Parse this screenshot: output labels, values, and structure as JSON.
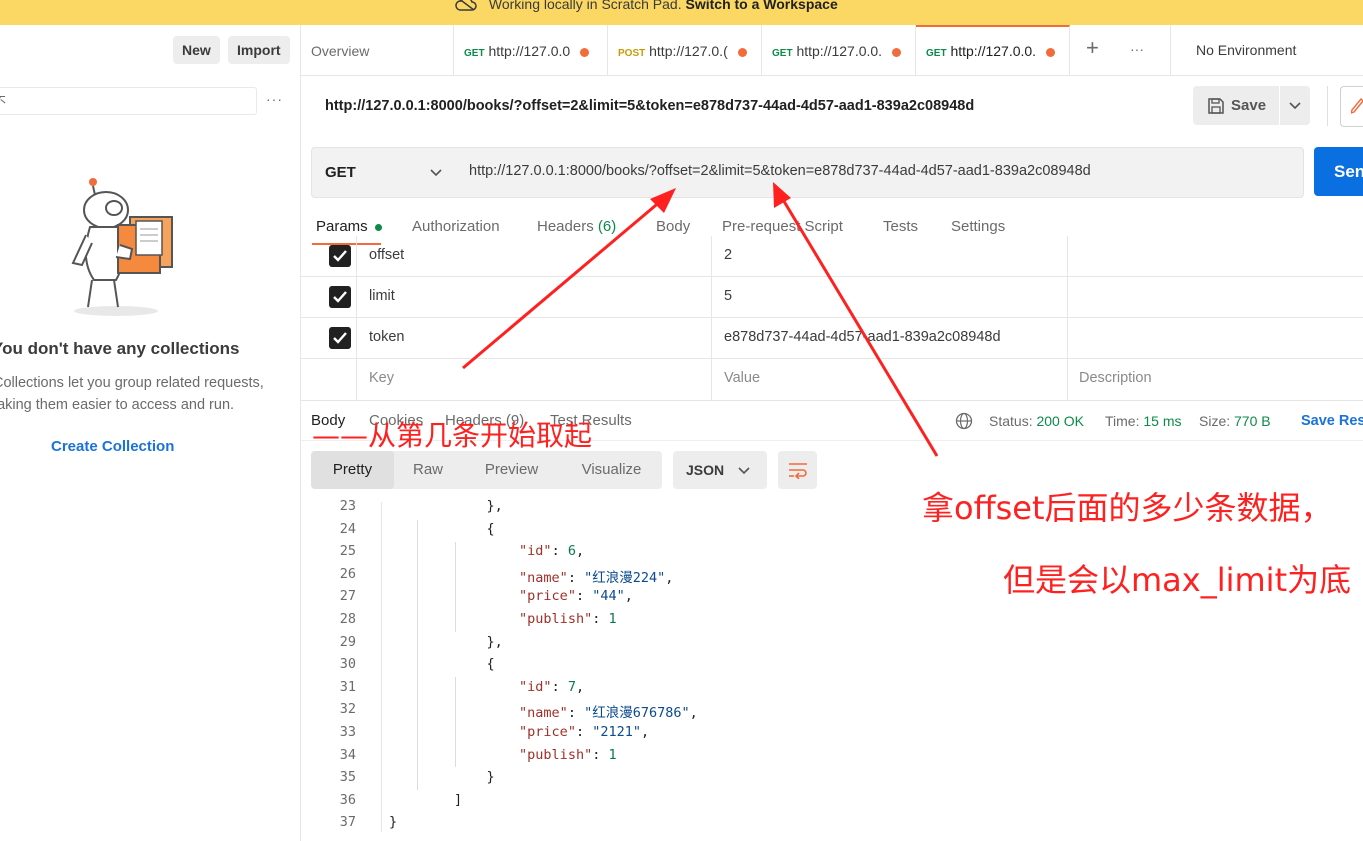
{
  "banner": {
    "text": "Working locally in Scratch Pad.",
    "link": "Switch to a Workspace"
  },
  "sidebar": {
    "new_label": "New",
    "import_label": "Import",
    "filter_fragment": "不",
    "more": "···",
    "empty_title": "You don't have any collections",
    "empty_desc_1": "Collections let you group related requests,",
    "empty_desc_2": "making them easier to access and run.",
    "create_label": "Create Collection"
  },
  "tabs": [
    {
      "label": "Overview"
    },
    {
      "method": "GET",
      "url": "http://127.0.0"
    },
    {
      "method": "POST",
      "url": "http://127.0.("
    },
    {
      "method": "GET",
      "url": "http://127.0.0."
    },
    {
      "method": "GET",
      "url": "http://127.0.0."
    }
  ],
  "tab_add": "+",
  "tab_more": "···",
  "environment": "No Environment",
  "request": {
    "title_url": "http://127.0.0.1:8000/books/?offset=2&limit=5&token=e878d737-44ad-4d57-aad1-839a2c08948d",
    "save_label": "Save",
    "method": "GET",
    "url": "http://127.0.0.1:8000/books/?offset=2&limit=5&token=e878d737-44ad-4d57-aad1-839a2c08948d",
    "send_label": "Send"
  },
  "subtabs": {
    "params": "Params",
    "authorization": "Authorization",
    "headers": "Headers",
    "headers_count": "(6)",
    "body": "Body",
    "prerequest": "Pre-request Script",
    "tests": "Tests",
    "settings": "Settings"
  },
  "params": [
    {
      "key": "offset",
      "value": "2"
    },
    {
      "key": "limit",
      "value": "5"
    },
    {
      "key": "token",
      "value": "e878d737-44ad-4d57-aad1-839a2c08948d"
    }
  ],
  "param_placeholders": {
    "key": "Key",
    "value": "Value",
    "description": "Description"
  },
  "response": {
    "tabs": {
      "body": "Body",
      "cookies": "Cookies",
      "headers": "Headers (9)",
      "test_results": "Test Results"
    },
    "status_label": "Status:",
    "status": "200 OK",
    "time_label": "Time:",
    "time": "15 ms",
    "size_label": "Size:",
    "size": "770 B",
    "save_label": "Save Response",
    "views": [
      "Pretty",
      "Raw",
      "Preview",
      "Visualize"
    ],
    "format": "JSON"
  },
  "code_lines": [
    {
      "n": "23",
      "t": "            },",
      "parts": []
    },
    {
      "n": "24",
      "t": "            {",
      "parts": []
    },
    {
      "n": "25",
      "key": "id",
      "num": "6",
      "indent": 16
    },
    {
      "n": "26",
      "key": "name",
      "str": "红浪漫224",
      "indent": 16
    },
    {
      "n": "27",
      "key": "price",
      "str": "44",
      "indent": 16
    },
    {
      "n": "28",
      "key": "publish",
      "num": "1",
      "indent": 16,
      "last": true
    },
    {
      "n": "29",
      "t": "            },",
      "parts": []
    },
    {
      "n": "30",
      "t": "            {",
      "parts": []
    },
    {
      "n": "31",
      "key": "id",
      "num": "7",
      "indent": 16
    },
    {
      "n": "32",
      "key": "name",
      "str": "红浪漫676786",
      "indent": 16
    },
    {
      "n": "33",
      "key": "price",
      "str": "2121",
      "indent": 16
    },
    {
      "n": "34",
      "key": "publish",
      "num": "1",
      "indent": 16,
      "last": true
    },
    {
      "n": "35",
      "t": "            }",
      "parts": []
    },
    {
      "n": "36",
      "t": "        ]",
      "parts": []
    },
    {
      "n": "37",
      "t": "}",
      "parts": []
    }
  ],
  "annotations": {
    "offset_note": "——从第几条开始取起",
    "limit_note_1": "拿offset后面的多少条数据，",
    "limit_note_2": "但是会以max_limit为底",
    "color": "#ff2020"
  },
  "colors": {
    "banner": "#fbd864",
    "accent": "#f26b3a",
    "send": "#0a6fe0",
    "link": "#1a73d9",
    "ok": "#0c8a4a"
  }
}
